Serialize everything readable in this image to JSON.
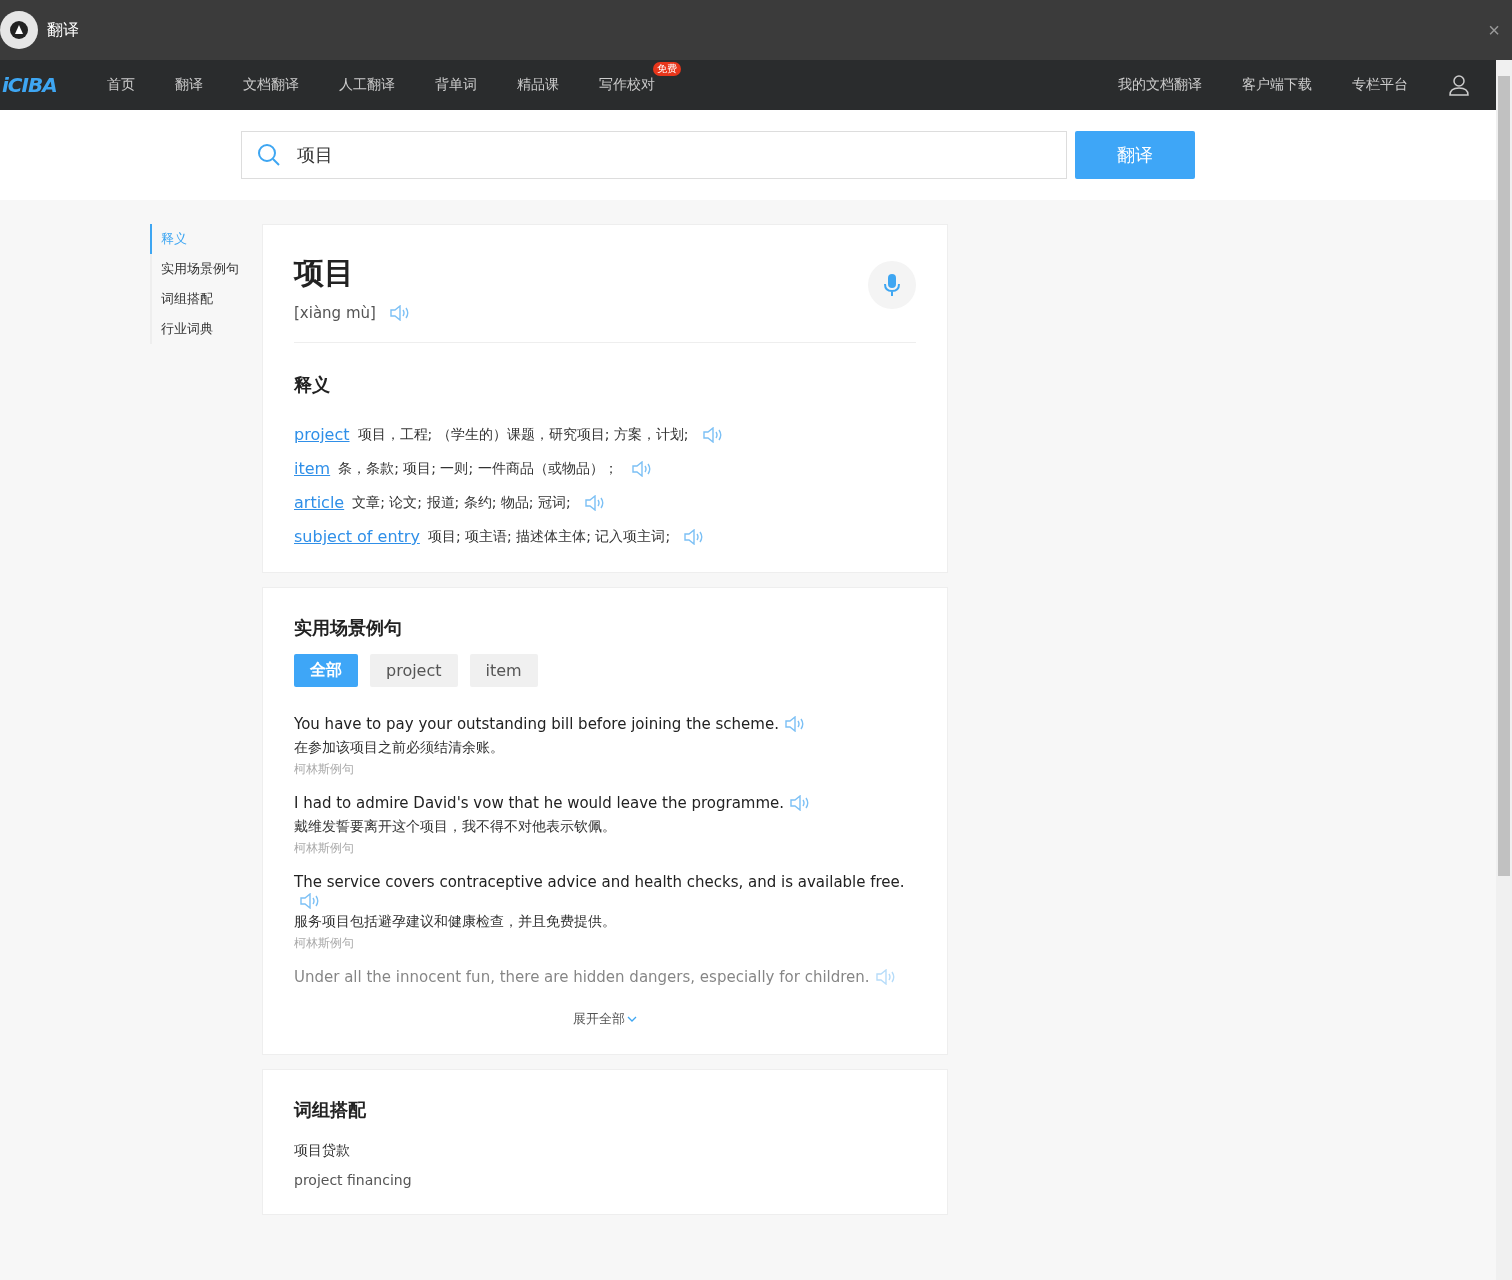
{
  "window": {
    "title": "翻译",
    "close": "×"
  },
  "nav": {
    "logo": "iCIBA",
    "items": [
      {
        "label": "首页"
      },
      {
        "label": "翻译"
      },
      {
        "label": "文档翻译"
      },
      {
        "label": "人工翻译"
      },
      {
        "label": "背单词"
      },
      {
        "label": "精品课"
      },
      {
        "label": "写作校对",
        "badge": "免费"
      }
    ],
    "right_items": [
      {
        "label": "我的文档翻译"
      },
      {
        "label": "客户端下载"
      },
      {
        "label": "专栏平台"
      }
    ]
  },
  "search": {
    "value": "项目",
    "button": "翻译"
  },
  "sidebar": {
    "items": [
      {
        "label": "释义",
        "selected": true
      },
      {
        "label": "实用场景例句",
        "selected": false
      },
      {
        "label": "词组搭配",
        "selected": false
      },
      {
        "label": "行业词典",
        "selected": false
      }
    ]
  },
  "entry": {
    "word": "项目",
    "pinyin": "[xiàng mù]"
  },
  "definitions": {
    "title": "释义",
    "items": [
      {
        "word": "project",
        "meaning": "项目，工程; （学生的）课题，研究项目; 方案，计划;"
      },
      {
        "word": "item",
        "meaning": "条，条款; 项目; 一则; 一件商品（或物品）；"
      },
      {
        "word": "article",
        "meaning": "文章; 论文; 报道; 条约; 物品; 冠词;"
      },
      {
        "word": "subject of entry",
        "meaning": "项目; 项主语; 描述体主体; 记入项主词;"
      }
    ]
  },
  "examples": {
    "title": "实用场景例句",
    "filters": [
      {
        "label": "全部",
        "selected": true
      },
      {
        "label": "project",
        "selected": false
      },
      {
        "label": "item",
        "selected": false
      }
    ],
    "items": [
      {
        "en": "You have to pay your outstanding bill before joining the scheme.",
        "zh": "在参加该项目之前必须结清余账。",
        "source": "柯林斯例句",
        "faded": false
      },
      {
        "en": "I had to admire David's vow that he would leave the programme.",
        "zh": "戴维发誓要离开这个项目，我不得不对他表示钦佩。",
        "source": "柯林斯例句",
        "faded": false
      },
      {
        "en": "The service covers contraceptive advice and health checks, and is available free.",
        "zh": "服务项目包括避孕建议和健康检查，并且免费提供。",
        "source": "柯林斯例句",
        "faded": false
      },
      {
        "en": "Under all the innocent fun, there are hidden dangers, especially for children.",
        "faded": true
      }
    ],
    "expand": "展开全部"
  },
  "phrases": {
    "title": "词组搭配",
    "items": [
      {
        "zh": "项目贷款",
        "en": "project financing"
      }
    ]
  }
}
